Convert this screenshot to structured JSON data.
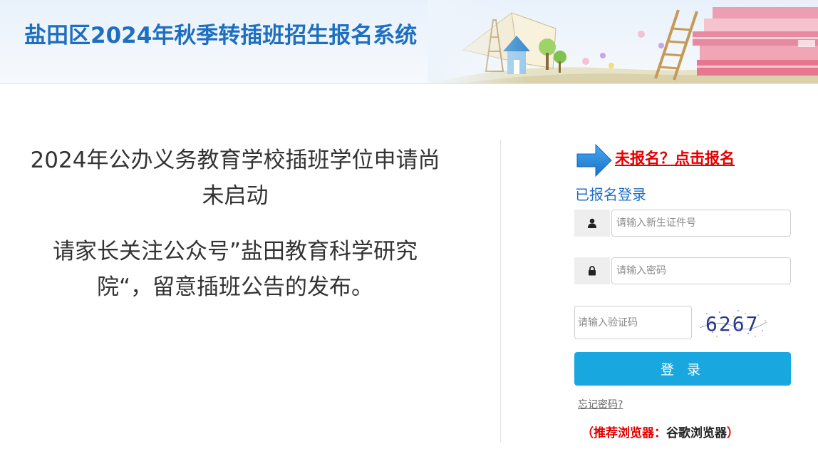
{
  "header": {
    "site_title": "盐田区2024年秋季转插班招生报名系统"
  },
  "notice": {
    "line1": "2024年公办义务教育学校插班学位申请尚未启动",
    "line2": "请家长关注公众号”盐田教育科学研究院“，留意插班公告的发布。"
  },
  "login": {
    "register_link": "未报名？点击报名",
    "title": "已报名登录",
    "id_placeholder": "请输入新生证件号",
    "password_placeholder": "请输入密码",
    "captcha_placeholder": "请输入验证码",
    "captcha_code": "6267",
    "login_button": "登 录",
    "forgot_password": "忘记密码?",
    "browser_tip_prefix": "（推荐浏览器：",
    "browser_tip_name": "谷歌浏览器",
    "browser_tip_suffix": "）"
  },
  "icons": {
    "user": "user-icon",
    "lock": "lock-icon",
    "arrow": "arrow-right-icon"
  },
  "colors": {
    "title_blue": "#1e6fc0",
    "link_red": "#e60000",
    "button_blue": "#19a7e0",
    "login_title_blue": "#1f6fc6"
  }
}
